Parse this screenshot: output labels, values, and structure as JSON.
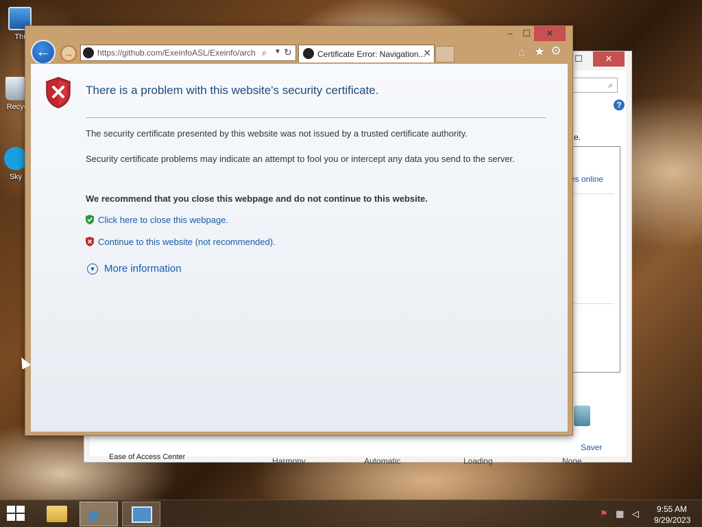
{
  "desktop": {
    "icons": [
      {
        "label": "Thi"
      },
      {
        "label": "Recyc"
      },
      {
        "label": "Sky"
      }
    ]
  },
  "background_window": {
    "search_icon": "search-icon",
    "help_label": "?",
    "text_e": "e.",
    "link_online": "es online",
    "saver_label": "Saver",
    "ease_of_access": "Ease of Access Center",
    "bottom_labels": [
      "Harmony",
      "Automatic",
      "Loading",
      "None"
    ]
  },
  "ie": {
    "window_controls": {
      "minimize": "–",
      "maximize": "☐",
      "close": "✕"
    },
    "back_label": "←",
    "forward_label": "→",
    "address": "https://github.com/ExeinfoASL/Exeinfo/arch",
    "tab_title": "Certificate Error: Navigation...",
    "tab_close": "✕",
    "toolbar_icons": [
      "home-icon",
      "star-icon",
      "gear-icon"
    ]
  },
  "page": {
    "heading": "There is a problem with this website's security certificate.",
    "para1": "The security certificate presented by this website was not issued by a trusted certificate authority.",
    "para2": "Security certificate problems may indicate an attempt to fool you or intercept any data you send to the server.",
    "recommend": "We recommend that you close this webpage and do not continue to this website.",
    "close_link": "Click here to close this webpage.",
    "continue_link": "Continue to this website (not recommended).",
    "more_info": "More information"
  },
  "taskbar": {
    "time": "9:55 AM",
    "date": "9/29/2023"
  },
  "colors": {
    "accent_link": "#1a5aa8",
    "heading": "#1f4a7a",
    "window_frame": "#c9a06f",
    "error_shield": "#c0282d",
    "ok_shield": "#2a9a3a"
  }
}
